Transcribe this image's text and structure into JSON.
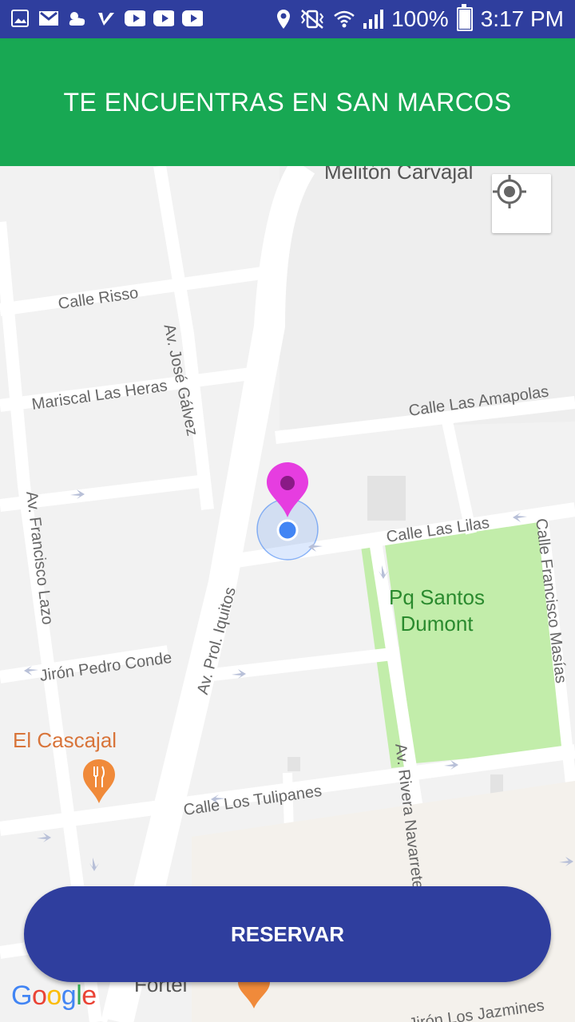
{
  "status_bar": {
    "battery": "100%",
    "time": "3:17 PM",
    "icons": [
      "image-icon",
      "gmail-icon",
      "weather-icon",
      "tasks-icon",
      "youtube-icon",
      "youtube-icon",
      "youtube-icon",
      "location-icon",
      "vibrate-icon",
      "wifi-icon",
      "signal-icon",
      "battery-icon"
    ]
  },
  "header": {
    "title": "TE ENCUENTRAS EN SAN MARCOS"
  },
  "map": {
    "street_labels": {
      "melliton": "Melitón Carvajal",
      "risso": "Calle Risso",
      "jose_galvez": "Av. José Gálvez",
      "mariscal": "Mariscal Las Heras",
      "amapolas": "Calle Las Amapolas",
      "francisco_lazo": "Av. Francisco Lazo",
      "lilas": "Calle Las Lilas",
      "francisco_masias": "Calle Francisco Masías",
      "iquitos": "Av. Prol. Iquitos",
      "pedro_conde": "Jirón Pedro Conde",
      "tulipanes": "Calle Los Tulipanes",
      "rivera": "Av. Rivera Navarrete",
      "jazmines": "Jirón Los Jazmines",
      "fortel": "Fortel"
    },
    "park_label": "Pq Santos\nDumont",
    "poi_label": "El Cascajal",
    "colors": {
      "park": "#c2edaa",
      "road": "#ffffff",
      "block": "#f2f2f2",
      "pin": "#e63de0",
      "dot": "#4285f4"
    }
  },
  "actions": {
    "reservar": "RESERVAR"
  },
  "google_logo": "Google"
}
